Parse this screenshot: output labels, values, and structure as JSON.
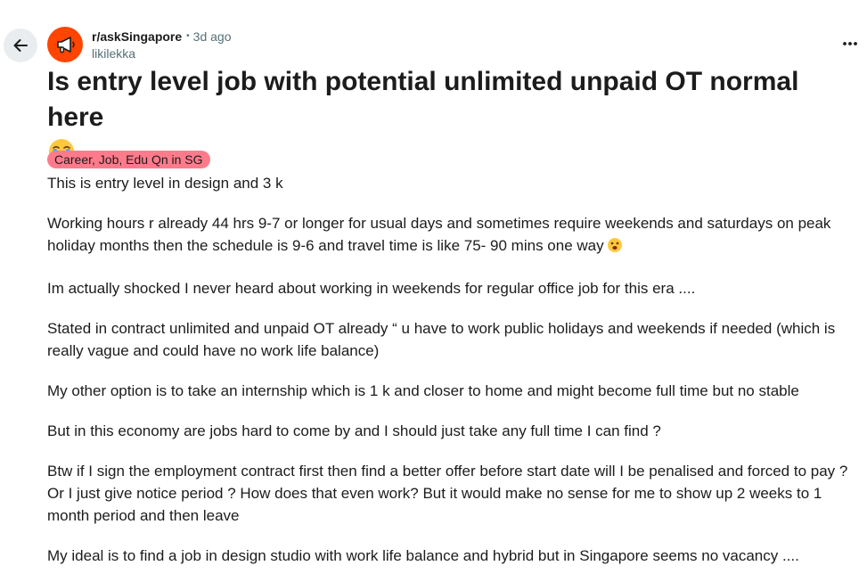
{
  "header": {
    "subreddit": "r/askSingapore",
    "separator": "•",
    "time_ago": "3d ago",
    "author": "likilekka"
  },
  "icons": {
    "back": "arrow-left-icon",
    "subreddit_avatar": "megaphone-icon",
    "more": "more-dots-icon",
    "title_emoji": "loudly-crying-face-emoji",
    "body_emoji": "face-with-open-mouth-emoji"
  },
  "colors": {
    "subreddit_accent": "#ff4500",
    "flair_bg": "#ff7b8c",
    "meta_gray": "#576f76"
  },
  "post": {
    "title": "Is entry level job with potential unlimited unpaid OT normal here",
    "flair": "Career, Job, Edu Qn in SG",
    "paragraphs": [
      "This is entry level in design and 3 k",
      "Working hours r already 44 hrs 9-7 or longer for usual days and sometimes require weekends and saturdays on peak holiday months then the schedule is 9-6 and travel time is like 75- 90 mins one way",
      "Im actually shocked I never heard about working in weekends for regular office job for this era ....",
      "Stated in contract unlimited and unpaid OT already “ u have to work public holidays and weekends if needed (which is really vague and could have no work life balance)",
      "My other option is to take an internship which is 1 k and closer to home and might become full time but no stable",
      "But in this economy are jobs hard to come by and I should just take any full time I can find ?",
      "Btw if I sign the employment contract first then find a better offer before start date will I be penalised and forced to pay ? Or I just give notice period ? How does that even work? But it would make no sense for me to show up 2 weeks to 1 month period and then leave",
      "My ideal is to find a job in design studio with work life balance and hybrid but in Singapore seems no vacancy ...."
    ]
  }
}
